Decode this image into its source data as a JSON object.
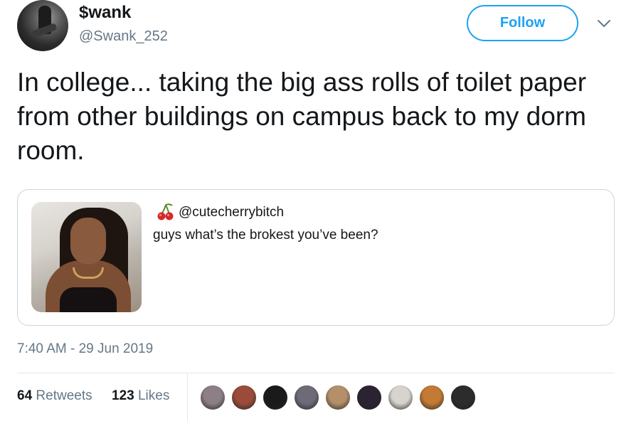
{
  "author": {
    "display_name": "$wank",
    "handle": "@Swank_252"
  },
  "follow_label": "Follow",
  "tweet": {
    "text": "In college...  taking the big ass rolls of toilet paper from other buildings on campus back to my dorm room."
  },
  "quoted": {
    "handle": "@cutecherrybitch",
    "text": "guys what’s the brokest you’ve been?",
    "icon": "cherry-icon"
  },
  "timestamp": "7:40 AM - 29 Jun 2019",
  "stats": {
    "retweets_count": "64",
    "retweets_label": "Retweets",
    "likes_count": "123",
    "likes_label": "Likes"
  },
  "likers": [
    {
      "color": "#8d7f86"
    },
    {
      "color": "#9a4b3a"
    },
    {
      "color": "#1a1a1a"
    },
    {
      "color": "#6f6a78"
    },
    {
      "color": "#b48f6a"
    },
    {
      "color": "#2b2332"
    },
    {
      "color": "#d7d3cf"
    },
    {
      "color": "#c27a35"
    },
    {
      "color": "#2c2c2c"
    }
  ],
  "colors": {
    "accent": "#1da1f2",
    "secondary_text": "#657786",
    "border": "#ccd6dd"
  }
}
